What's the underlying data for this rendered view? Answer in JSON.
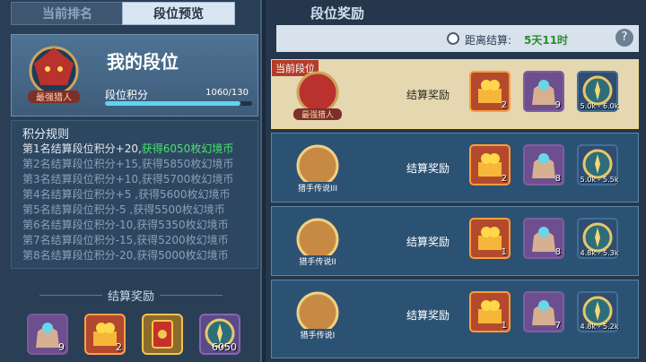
{
  "left": {
    "tabs": [
      "当前排名",
      "段位预览"
    ],
    "my_rank_title": "我的段位",
    "emblem_name": "最强猎人",
    "points_label": "段位积分",
    "points_value": "1060/130",
    "progress": 0.92,
    "rules_title": "积分规则",
    "rules": [
      {
        "text": "第1名结算段位积分+20,",
        "reward": "获得6050枚幻境币"
      },
      {
        "text": "第2名结算段位积分+15,",
        "reward": "获得5850枚幻境币"
      },
      {
        "text": "第3名结算段位积分+10,",
        "reward": "获得5700枚幻境币"
      },
      {
        "text": "第4名结算段位积分+5 ,",
        "reward": "获得5600枚幻境币"
      },
      {
        "text": "第5名结算段位积分-5 ,",
        "reward": "获得5500枚幻境币"
      },
      {
        "text": "第6名结算段位积分-10,",
        "reward": "获得5350枚幻境币"
      },
      {
        "text": "第7名结算段位积分-15,",
        "reward": "获得5200枚幻境币"
      },
      {
        "text": "第8名结算段位积分-20,",
        "reward": "获得5000枚幻境币"
      }
    ],
    "settle_label": "结算奖励",
    "items": [
      {
        "icon": "bag-icon",
        "count": "9"
      },
      {
        "icon": "chest-icon",
        "count": "2"
      },
      {
        "icon": "card-icon",
        "count": ""
      },
      {
        "icon": "coin-icon",
        "count": "6050"
      }
    ]
  },
  "right": {
    "title": "段位奖励",
    "timer_label": "距离结算:",
    "timer_value": "5天11时",
    "help": "?",
    "current_tag": "当前段位",
    "tiers": [
      {
        "name": "最强猎人",
        "label": "结算奖励",
        "chest": "2",
        "bag": "9",
        "coins": "5.0k - 6.0k"
      },
      {
        "name": "猎手传说III",
        "label": "结算奖励",
        "chest": "2",
        "bag": "8",
        "coins": "5.0k - 5.5k"
      },
      {
        "name": "猎手传说II",
        "label": "结算奖励",
        "chest": "1",
        "bag": "8",
        "coins": "4.8k - 5.3k"
      },
      {
        "name": "猎手传说I",
        "label": "结算奖励",
        "chest": "1",
        "bag": "7",
        "coins": "4.8k - 5.2k"
      }
    ]
  }
}
